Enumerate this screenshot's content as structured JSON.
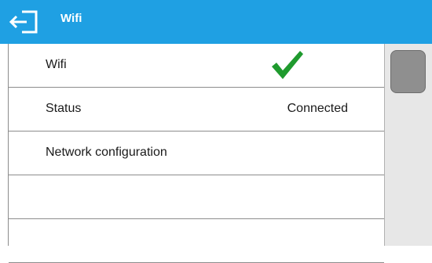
{
  "header": {
    "title": "Wifi",
    "back_icon": "exit-arrow-icon",
    "background_color": "#1fa0e3"
  },
  "rows": [
    {
      "label": "Wifi",
      "value": "",
      "icon": "checkmark-icon",
      "icon_color": "#1f9a2e"
    },
    {
      "label": "Status",
      "value": "Connected"
    },
    {
      "label": "Network configuration",
      "value": ""
    },
    {
      "label": "",
      "value": ""
    },
    {
      "label": "",
      "value": ""
    }
  ]
}
